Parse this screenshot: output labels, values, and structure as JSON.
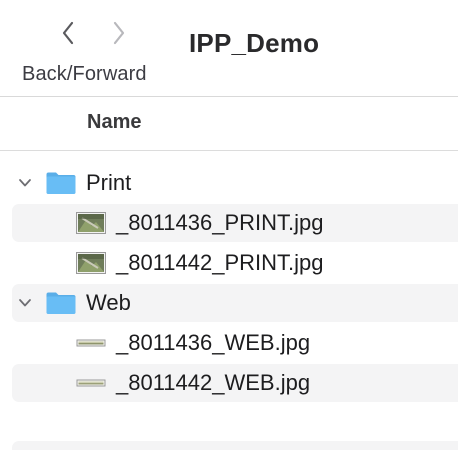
{
  "toolbar": {
    "back_icon": "chevron-left-icon",
    "forward_icon": "chevron-right-icon",
    "nav_caption": "Back/Forward",
    "title": "IPP_Demo"
  },
  "columns": {
    "name": "Name"
  },
  "folders": [
    {
      "name": "Print",
      "icon": "folder-icon",
      "expanded": true,
      "files": [
        {
          "name": "_8011436_PRINT.jpg",
          "icon": "photo-thumbnail-icon"
        },
        {
          "name": "_8011442_PRINT.jpg",
          "icon": "photo-thumbnail-icon"
        }
      ]
    },
    {
      "name": "Web",
      "icon": "folder-icon",
      "expanded": true,
      "files": [
        {
          "name": "_8011436_WEB.jpg",
          "icon": "panorama-thumbnail-icon"
        },
        {
          "name": "_8011442_WEB.jpg",
          "icon": "panorama-thumbnail-icon"
        }
      ]
    }
  ],
  "colors": {
    "folder_blue": "#5db4f2",
    "stripe": "#f4f4f5",
    "text": "#1d1d1f"
  }
}
